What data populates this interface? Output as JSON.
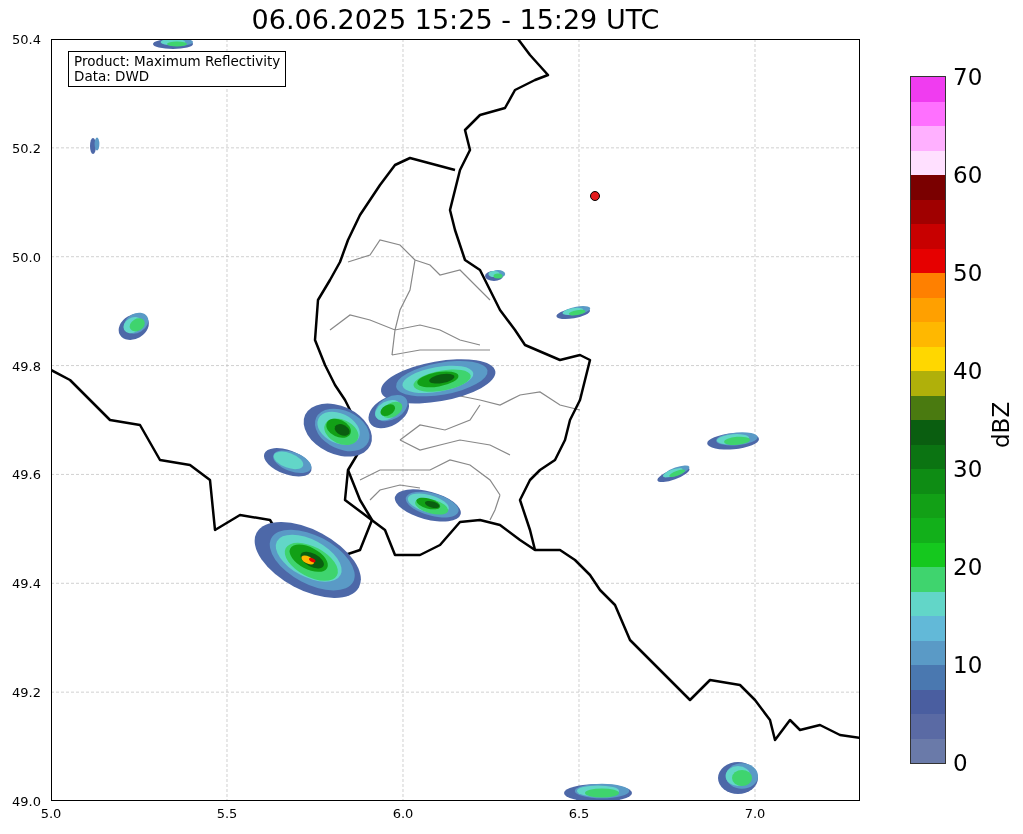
{
  "title": "06.06.2025 15:25 - 15:29 UTC",
  "info_box": {
    "lines": [
      "Product: Maximum Reflectivity",
      "Data: DWD"
    ]
  },
  "map": {
    "x_ticks": [
      "5.0",
      "5.5",
      "6.0",
      "6.5",
      "7.0"
    ],
    "y_ticks": [
      "50.4",
      "50.2",
      "50.0",
      "49.8",
      "49.6",
      "49.4",
      "49.2",
      "49.0"
    ]
  },
  "colorbar": {
    "label": "dBZ",
    "ticks": [
      "70",
      "60",
      "50",
      "40",
      "30",
      "20",
      "10",
      "0"
    ],
    "bands": [
      {
        "color": "#f03cf0"
      },
      {
        "color": "#ff70ff"
      },
      {
        "color": "#ffb0ff"
      },
      {
        "color": "#ffe0ff"
      },
      {
        "color": "#7a0000"
      },
      {
        "color": "#a00000"
      },
      {
        "color": "#c80000"
      },
      {
        "color": "#e60000"
      },
      {
        "color": "#ff8000"
      },
      {
        "color": "#ffa000"
      },
      {
        "color": "#ffb800"
      },
      {
        "color": "#ffd700"
      },
      {
        "color": "#b0b00a"
      },
      {
        "color": "#4a7a10"
      },
      {
        "color": "#0a5e10"
      },
      {
        "color": "#0b7412"
      },
      {
        "color": "#0e8c14"
      },
      {
        "color": "#12a016"
      },
      {
        "color": "#12b01a"
      },
      {
        "color": "#15c81e"
      },
      {
        "color": "#3fd46e"
      },
      {
        "color": "#62d6c8"
      },
      {
        "color": "#62b9d8"
      },
      {
        "color": "#5a9ac6"
      },
      {
        "color": "#4a78b0"
      },
      {
        "color": "#4a5ea0"
      },
      {
        "color": "#5a6aa4"
      },
      {
        "color": "#6a7aa9"
      }
    ]
  }
}
